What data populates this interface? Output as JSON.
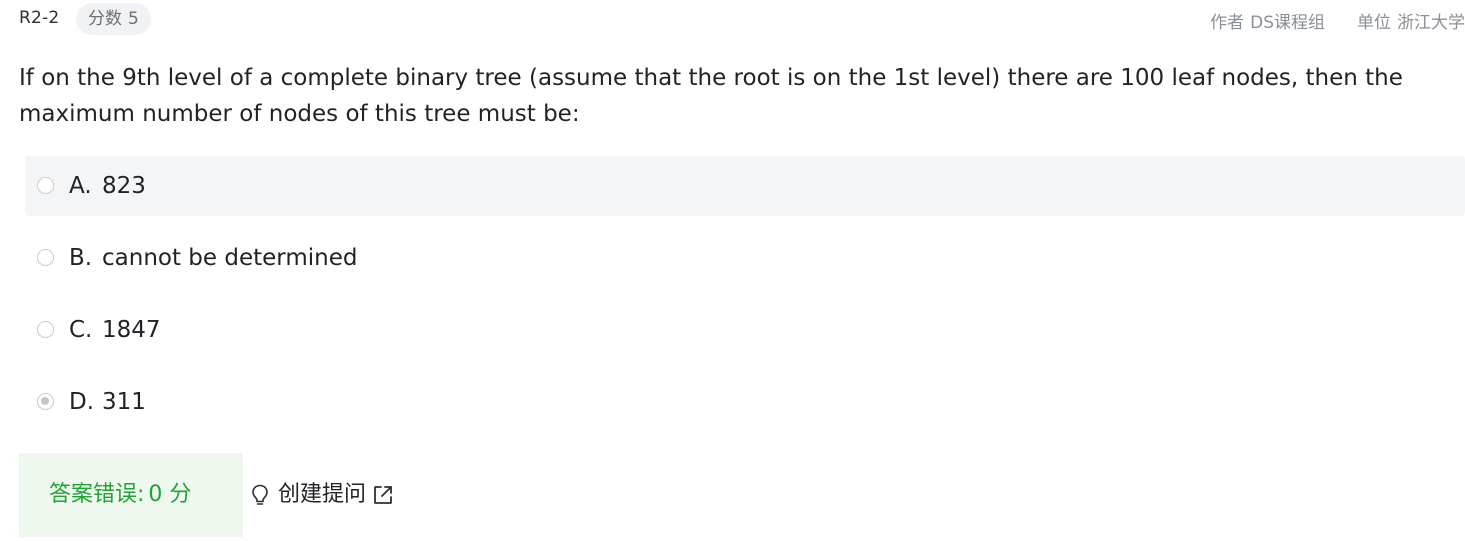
{
  "header": {
    "question_id": "R2-2",
    "score_label": "分数",
    "score_value": "5",
    "author_label": "作者",
    "author_value": "DS课程组",
    "unit_label": "单位",
    "unit_value": "浙江大学"
  },
  "question": {
    "text": "If on the 9th level of a complete binary tree (assume that the root is on the 1st level) there are 100 leaf nodes, then the maximum number of nodes of this tree must be:"
  },
  "options": [
    {
      "letter": "A.",
      "text": "823",
      "selected": false,
      "hovered": true
    },
    {
      "letter": "B.",
      "text": "cannot be determined",
      "selected": false,
      "hovered": false
    },
    {
      "letter": "C.",
      "text": "1847",
      "selected": false,
      "hovered": false
    },
    {
      "letter": "D.",
      "text": "311",
      "selected": true,
      "hovered": false
    }
  ],
  "result": {
    "label": "答案错误:",
    "score": "0 分"
  },
  "ask": {
    "label": "创建提问",
    "bulb_icon": "lightbulb-icon",
    "external_icon": "external-link-icon"
  },
  "colors": {
    "correct_green": "#21a334",
    "result_bg": "#eef8ef",
    "hover_bg": "#f4f5f7",
    "muted_text": "#8a8f96"
  }
}
